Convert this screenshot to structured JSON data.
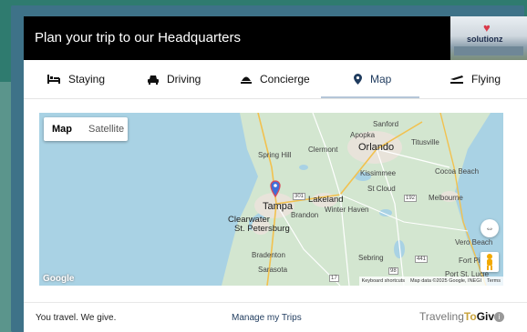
{
  "header": {
    "title": "Plan your trip to our Headquarters",
    "logo_text": "solutionz"
  },
  "tabs": [
    {
      "label": "Staying",
      "icon": "bed-icon"
    },
    {
      "label": "Driving",
      "icon": "car-icon"
    },
    {
      "label": "Concierge",
      "icon": "bell-icon"
    },
    {
      "label": "Map",
      "icon": "map-pin-icon",
      "active": true
    },
    {
      "label": "Flying",
      "icon": "plane-icon"
    }
  ],
  "map": {
    "type_map": "Map",
    "type_satellite": "Satellite",
    "labels": {
      "sanford": "Sanford",
      "apopka": "Apopka",
      "clermont": "Clermont",
      "orlando": "Orlando",
      "titusville": "Titusville",
      "spring_hill": "Spring Hill",
      "kissimmee": "Kissimmee",
      "cocoa_beach": "Cocoa Beach",
      "st_cloud": "St Cloud",
      "lakeland": "Lakeland",
      "tampa": "Tampa",
      "winter_haven": "Winter Haven",
      "brandon": "Brandon",
      "melbourne": "Melbourne",
      "clearwater": "Clearwater",
      "st_petersburg": "St. Petersburg",
      "bradenton": "Bradenton",
      "sebring": "Sebring",
      "sarasota": "Sarasota",
      "vero_beach": "Vero Beach",
      "fort_pierce": "Fort Pierce",
      "port_st_lucie": "Port St. Lucie",
      "spring_hill_num": "",
      "hwy_301": "301",
      "hwy_98": "98",
      "hwy_17": "17",
      "hwy_441": "441",
      "hwy_192": "192"
    },
    "google": "Google",
    "attribution": {
      "shortcuts": "Keyboard shortcuts",
      "data": "Map data ©2025 Google, INEGI",
      "terms": "Terms"
    }
  },
  "footer": {
    "tagline": "You travel. We give.",
    "manage": "Manage my Trips",
    "brand_left": "Traveling",
    "brand_to": "To",
    "brand_right": "Give",
    "info": "i"
  }
}
